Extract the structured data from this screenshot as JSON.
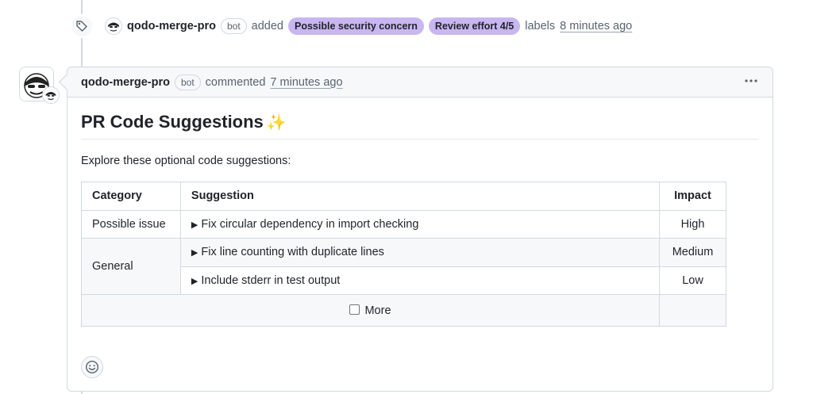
{
  "event": {
    "author": "qodo-merge-pro",
    "bot_badge": "bot",
    "action": "added",
    "labels": [
      "Possible security concern",
      "Review effort 4/5"
    ],
    "suffix": "labels",
    "time": "8 minutes ago"
  },
  "comment": {
    "author": "qodo-merge-pro",
    "bot_badge": "bot",
    "action": "commented",
    "time": "7 minutes ago",
    "menu_icon": "kebab-horizontal-icon",
    "title": "PR Code Suggestions",
    "title_emoji": "✨",
    "intro": "Explore these optional code suggestions:",
    "table": {
      "headers": [
        "Category",
        "Suggestion",
        "Impact"
      ],
      "rows": [
        {
          "category": "Possible issue",
          "suggestion": "Fix circular dependency in import checking",
          "impact": "High"
        },
        {
          "category": "General",
          "suggestion": "Fix line counting with duplicate lines",
          "impact": "Medium"
        },
        {
          "category": "",
          "suggestion": "Include stderr in test output",
          "impact": "Low"
        }
      ],
      "more_label": "More"
    }
  },
  "icons": {
    "event": "tag-icon",
    "reaction": "smiley-icon"
  }
}
